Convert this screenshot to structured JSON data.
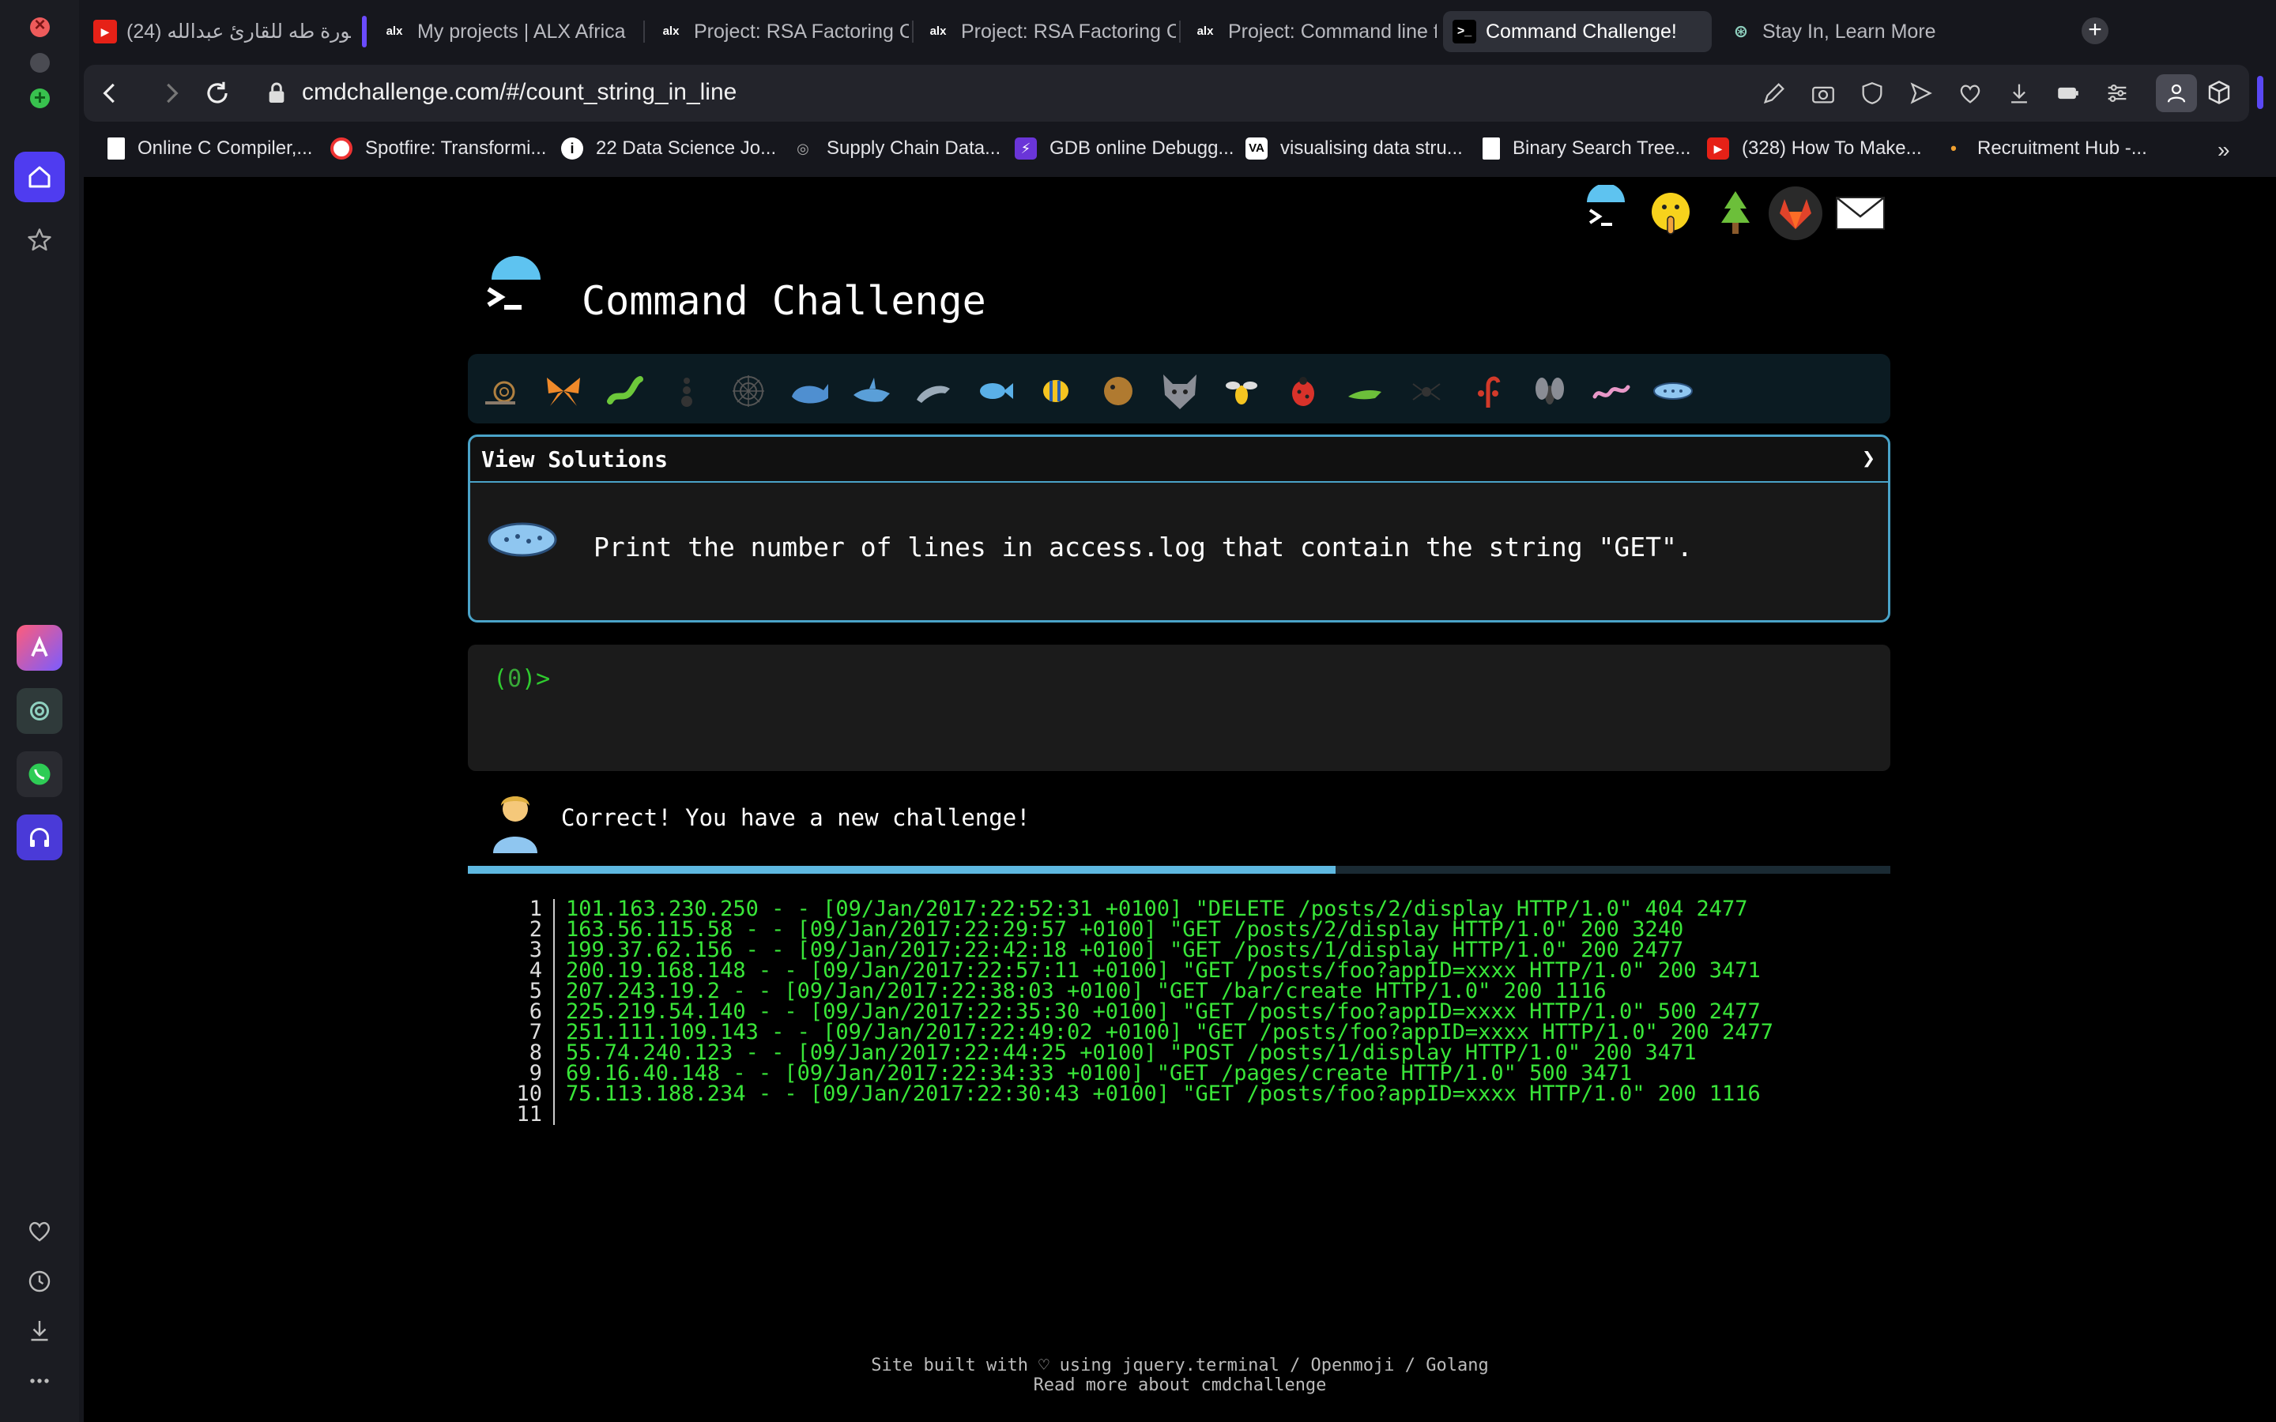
{
  "browser": {
    "tabs": [
      {
        "label": "(24) سورة طه للقارئ عبدالله",
        "icon": "youtube-icon",
        "active": false
      },
      {
        "label": "My projects | ALX Africa",
        "icon": "alx-icon",
        "active": false
      },
      {
        "label": "Project: RSA Factoring C",
        "icon": "alx-icon",
        "active": false
      },
      {
        "label": "Project: RSA Factoring C",
        "icon": "alx-icon",
        "active": false
      },
      {
        "label": "Project: Command line fo",
        "icon": "alx-icon",
        "active": false
      },
      {
        "label": "Command Challenge!",
        "icon": "terminal-icon",
        "active": true
      },
      {
        "label": "Stay In, Learn More",
        "icon": "openai-icon",
        "active": false
      }
    ],
    "url": "cmdchallenge.com/#/count_string_in_line",
    "bookmarks": [
      {
        "label": "Online C Compiler,...",
        "icon": "doc-icon"
      },
      {
        "label": "Spotfire: Transformi...",
        "icon": "spotfire-icon"
      },
      {
        "label": "22 Data Science Jo...",
        "icon": "info-icon"
      },
      {
        "label": "Supply Chain Data...",
        "icon": "medal-icon"
      },
      {
        "label": "GDB online Debugg...",
        "icon": "bolt-icon"
      },
      {
        "label": "visualising data stru...",
        "icon": "va-icon"
      },
      {
        "label": "Binary Search Tree...",
        "icon": "doc-icon"
      },
      {
        "label": "(328) How To Make...",
        "icon": "youtube-icon"
      },
      {
        "label": "Recruitment Hub -...",
        "icon": "dot-icon"
      }
    ]
  },
  "page": {
    "title": "Command Challenge",
    "view_solutions_label": "View Solutions",
    "view_solutions_arrow": "❯",
    "challenge_text": "Print the number of lines in access.log that contain the string \"GET\".",
    "prompt_prefix": "(",
    "prompt_num": "0",
    "prompt_suffix": ")>",
    "feedback": "Correct! You have a new challenge!",
    "progress_fraction": 0.61,
    "log_lines": [
      "101.163.230.250 - - [09/Jan/2017:22:52:31 +0100] \"DELETE /posts/2/display HTTP/1.0\" 404 2477",
      "163.56.115.58 - - [09/Jan/2017:22:29:57 +0100] \"GET /posts/2/display HTTP/1.0\" 200 3240",
      "199.37.62.156 - - [09/Jan/2017:22:42:18 +0100] \"GET /posts/1/display HTTP/1.0\" 200 2477",
      "200.19.168.148 - - [09/Jan/2017:22:57:11 +0100] \"GET /posts/foo?appID=xxxx HTTP/1.0\" 200 3471",
      "207.243.19.2 - - [09/Jan/2017:22:38:03 +0100] \"GET /bar/create HTTP/1.0\" 200 1116",
      "225.219.54.140 - - [09/Jan/2017:22:35:30 +0100] \"GET /posts/foo?appID=xxxx HTTP/1.0\" 500 2477",
      "251.111.109.143 - - [09/Jan/2017:22:49:02 +0100] \"GET /posts/foo?appID=xxxx HTTP/1.0\" 200 2477",
      "55.74.240.123 - - [09/Jan/2017:22:44:25 +0100] \"POST /posts/1/display HTTP/1.0\" 200 3471",
      "69.16.40.148 - - [09/Jan/2017:22:34:33 +0100] \"GET /pages/create HTTP/1.0\" 500 3471",
      "75.113.188.234 - - [09/Jan/2017:22:30:43 +0100] \"GET /posts/foo?appID=xxxx HTTP/1.0\" 200 1116",
      ""
    ],
    "footer_line1": "Site built with ♡ using jquery.terminal / Openmoji / Golang",
    "footer_line2": "Read more about cmdchallenge"
  },
  "colors": {
    "accent": "#4f3cf0",
    "terminal_green": "#39e639",
    "border_blue": "#4aa3c8"
  }
}
